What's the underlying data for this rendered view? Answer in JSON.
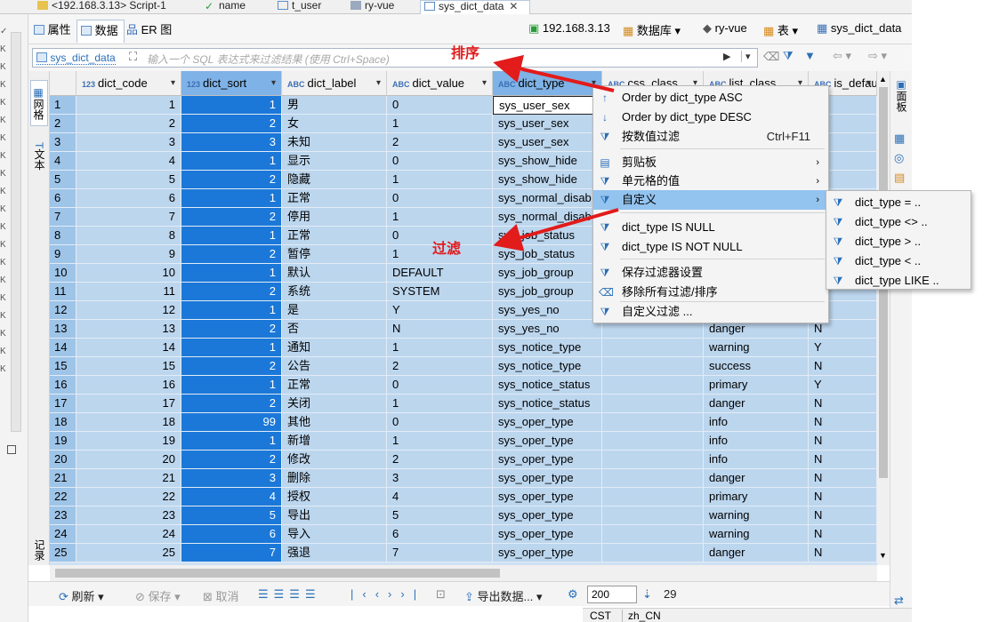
{
  "editor_tabs": [
    "<192.168.3.13> Script-1",
    "name",
    "t_user",
    "ry-vue",
    "sys_dict_data"
  ],
  "sub_tabs": [
    "属性",
    "数据",
    "ER 图"
  ],
  "breadcrumb": {
    "host": "192.168.3.13",
    "database_label": "数据库",
    "database": "ry-vue",
    "table_label": "表",
    "table": "sys_dict_data"
  },
  "filter": {
    "table_chip": "sys_dict_data",
    "placeholder": "输入一个 SQL 表达式来过滤结果 (使用 Ctrl+Space)"
  },
  "side_left_labels": [
    "网格",
    "文本",
    "记录"
  ],
  "side_right_labels": [
    "面板"
  ],
  "columns": [
    {
      "type": "123",
      "name": "dict_code"
    },
    {
      "type": "123",
      "name": "dict_sort"
    },
    {
      "type": "ABC",
      "name": "dict_label"
    },
    {
      "type": "ABC",
      "name": "dict_value"
    },
    {
      "type": "ABC",
      "name": "dict_type"
    },
    {
      "type": "ABC",
      "name": "css_class"
    },
    {
      "type": "ABC",
      "name": "list_class"
    },
    {
      "type": "ABC",
      "name": "is_default"
    }
  ],
  "rows": [
    [
      "1",
      "1",
      "1",
      "男",
      "0",
      "sys_user_sex",
      "",
      "",
      ""
    ],
    [
      "2",
      "2",
      "2",
      "女",
      "1",
      "sys_user_sex",
      "",
      "",
      ""
    ],
    [
      "3",
      "3",
      "3",
      "未知",
      "2",
      "sys_user_sex",
      "",
      "",
      ""
    ],
    [
      "4",
      "4",
      "1",
      "显示",
      "0",
      "sys_show_hide",
      "",
      "",
      ""
    ],
    [
      "5",
      "5",
      "2",
      "隐藏",
      "1",
      "sys_show_hide",
      "",
      "",
      ""
    ],
    [
      "6",
      "6",
      "1",
      "正常",
      "0",
      "sys_normal_disab",
      "",
      "",
      ""
    ],
    [
      "7",
      "7",
      "2",
      "停用",
      "1",
      "sys_normal_disab",
      "",
      "",
      ""
    ],
    [
      "8",
      "8",
      "1",
      "正常",
      "0",
      "sys_job_status",
      "",
      "",
      ""
    ],
    [
      "9",
      "9",
      "2",
      "暂停",
      "1",
      "sys_job_status",
      "",
      "",
      ""
    ],
    [
      "10",
      "10",
      "1",
      "默认",
      "DEFAULT",
      "sys_job_group",
      "",
      "",
      ""
    ],
    [
      "11",
      "11",
      "2",
      "系统",
      "SYSTEM",
      "sys_job_group",
      "",
      "",
      ""
    ],
    [
      "12",
      "12",
      "1",
      "是",
      "Y",
      "sys_yes_no",
      "",
      "",
      ""
    ],
    [
      "13",
      "13",
      "2",
      "否",
      "N",
      "sys_yes_no",
      "",
      "danger",
      "N"
    ],
    [
      "14",
      "14",
      "1",
      "通知",
      "1",
      "sys_notice_type",
      "",
      "warning",
      "Y"
    ],
    [
      "15",
      "15",
      "2",
      "公告",
      "2",
      "sys_notice_type",
      "",
      "success",
      "N"
    ],
    [
      "16",
      "16",
      "1",
      "正常",
      "0",
      "sys_notice_status",
      "",
      "primary",
      "Y"
    ],
    [
      "17",
      "17",
      "2",
      "关闭",
      "1",
      "sys_notice_status",
      "",
      "danger",
      "N"
    ],
    [
      "18",
      "18",
      "99",
      "其他",
      "0",
      "sys_oper_type",
      "",
      "info",
      "N"
    ],
    [
      "19",
      "19",
      "1",
      "新增",
      "1",
      "sys_oper_type",
      "",
      "info",
      "N"
    ],
    [
      "20",
      "20",
      "2",
      "修改",
      "2",
      "sys_oper_type",
      "",
      "info",
      "N"
    ],
    [
      "21",
      "21",
      "3",
      "删除",
      "3",
      "sys_oper_type",
      "",
      "danger",
      "N"
    ],
    [
      "22",
      "22",
      "4",
      "授权",
      "4",
      "sys_oper_type",
      "",
      "primary",
      "N"
    ],
    [
      "23",
      "23",
      "5",
      "导出",
      "5",
      "sys_oper_type",
      "",
      "warning",
      "N"
    ],
    [
      "24",
      "24",
      "6",
      "导入",
      "6",
      "sys_oper_type",
      "",
      "warning",
      "N"
    ],
    [
      "25",
      "25",
      "7",
      "强退",
      "7",
      "sys_oper_type",
      "",
      "danger",
      "N"
    ]
  ],
  "context_menu": [
    {
      "icon": "sort-asc-icon",
      "label": "Order by dict_type ASC"
    },
    {
      "icon": "sort-desc-icon",
      "label": "Order by dict_type DESC"
    },
    {
      "icon": "filter-value-icon",
      "label": "按数值过滤",
      "shortcut": "Ctrl+F11"
    },
    {
      "icon": "clipboard-icon",
      "label": "剪贴板",
      "submenu": true
    },
    {
      "icon": "filter-cell-icon",
      "label": "单元格的值",
      "submenu": true
    },
    {
      "icon": "filter-custom-icon",
      "label": "自定义",
      "submenu": true,
      "highlight": true
    },
    {
      "icon": "filter-null-icon",
      "label": "dict_type IS NULL"
    },
    {
      "icon": "filter-notnull-icon",
      "label": "dict_type IS NOT NULL"
    },
    {
      "icon": "filter-settings-icon",
      "label": "保存过滤器设置"
    },
    {
      "icon": "eraser-icon",
      "label": "移除所有过滤/排序"
    },
    {
      "icon": "filter-edit-icon",
      "label": "自定义过滤 ..."
    }
  ],
  "submenu": [
    "dict_type = ..",
    "dict_type <> ..",
    "dict_type > ..",
    "dict_type < ..",
    "dict_type LIKE .."
  ],
  "annotations": {
    "sort": "排序",
    "filter": "过滤"
  },
  "bottom": {
    "refresh": "刷新",
    "save": "保存",
    "cancel": "取消",
    "export": "导出数据...",
    "fetch_size": "200",
    "row_count": "29"
  },
  "status": {
    "timezone": "CST",
    "locale": "zh_CN"
  },
  "colors": {
    "selection": "#bcd6ee",
    "sort_column": "#1b78d8",
    "menu_highlight": "#93c3ef",
    "annotation": "#e21b1b"
  }
}
